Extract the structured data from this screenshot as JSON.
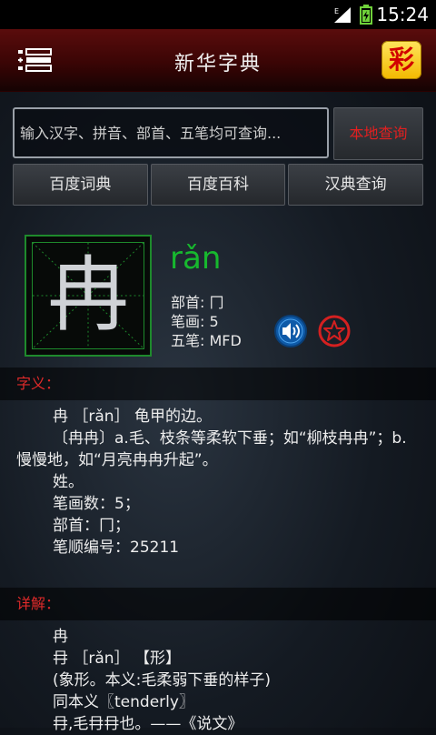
{
  "status_bar": {
    "time": "15:24",
    "network": "E"
  },
  "header": {
    "title": "新华字典",
    "cai_label": "彩"
  },
  "search": {
    "placeholder": "输入汉字、拼音、部首、五笔均可查询...",
    "button_label": "本地查询"
  },
  "external_links": [
    {
      "label": "百度词典"
    },
    {
      "label": "百度百科"
    },
    {
      "label": "汉典查询"
    }
  ],
  "character": {
    "glyph": "冉",
    "pinyin": "rǎn",
    "radical": "部首: 冂",
    "strokes": "笔画: 5",
    "wubi": "五笔: MFD"
  },
  "meaning": {
    "heading": "字义：",
    "lines": [
      "冉 ［rǎn］ 龟甲的边。",
      "〔冉冉〕a.毛、枝条等柔软下垂；如“柳枝冉冉”；b.慢慢地，如“月亮冉冉升起”。",
      "姓。",
      "笔画数：5；",
      "部首：冂；",
      "笔顺编号：25211"
    ]
  },
  "detail": {
    "heading": "详解：",
    "lines": [
      "冉",
      "冄 ［rǎn］ 【形】",
      "(象形。本义:毛柔弱下垂的样子)",
      "同本义〖tenderly〗",
      "冄,毛冄冄也。——《说文》"
    ]
  },
  "colors": {
    "accent_red": "#e02a2a",
    "pinyin_green": "#17b82e",
    "cai_yellow": "#f2b900"
  }
}
